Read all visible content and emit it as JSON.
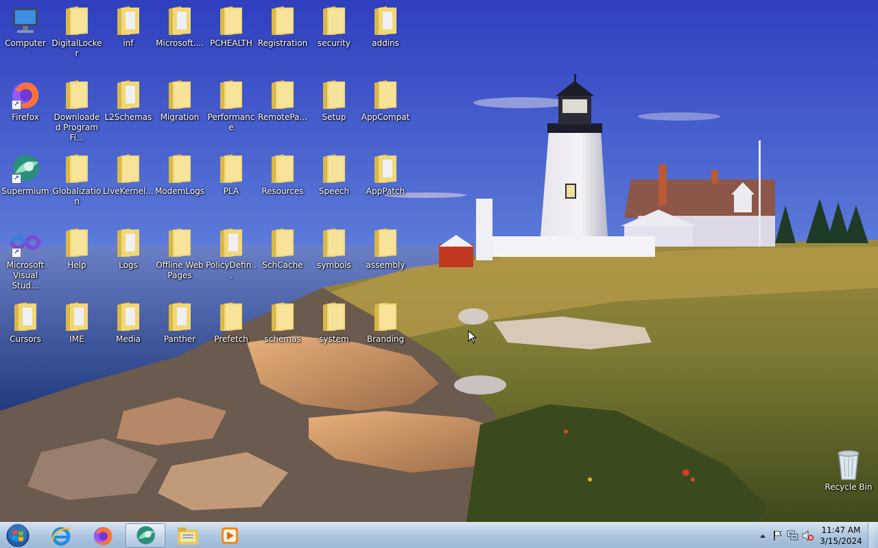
{
  "desktop": {
    "icons": [
      {
        "label": "Computer",
        "icon": "computer-icon"
      },
      {
        "label": "DigitalLocker",
        "icon": "folder-icon"
      },
      {
        "label": "inf",
        "icon": "folder-icon"
      },
      {
        "label": "Microsoft....",
        "icon": "folder-icon"
      },
      {
        "label": "PCHEALTH",
        "icon": "folder-icon"
      },
      {
        "label": "Registration",
        "icon": "folder-icon"
      },
      {
        "label": "security",
        "icon": "folder-icon"
      },
      {
        "label": "addins",
        "icon": "folder-icon"
      },
      {
        "label": "Firefox",
        "icon": "firefox-icon"
      },
      {
        "label": "Downloaded Program Fi...",
        "icon": "folder-icon"
      },
      {
        "label": "L2Schemas",
        "icon": "folder-icon"
      },
      {
        "label": "Migration",
        "icon": "folder-icon"
      },
      {
        "label": "Performance",
        "icon": "folder-icon"
      },
      {
        "label": "RemotePa...",
        "icon": "folder-icon"
      },
      {
        "label": "Setup",
        "icon": "folder-icon"
      },
      {
        "label": "AppCompat",
        "icon": "folder-icon"
      },
      {
        "label": "Supermium",
        "icon": "supermium-icon"
      },
      {
        "label": "Globalization",
        "icon": "folder-icon"
      },
      {
        "label": "LiveKernel...",
        "icon": "folder-icon"
      },
      {
        "label": "ModemLogs",
        "icon": "folder-icon"
      },
      {
        "label": "PLA",
        "icon": "folder-icon"
      },
      {
        "label": "Resources",
        "icon": "folder-icon"
      },
      {
        "label": "Speech",
        "icon": "folder-icon"
      },
      {
        "label": "AppPatch",
        "icon": "folder-icon"
      },
      {
        "label": "Microsoft Visual Stud...",
        "icon": "visual-studio-icon"
      },
      {
        "label": "Help",
        "icon": "folder-icon"
      },
      {
        "label": "Logs",
        "icon": "folder-icon"
      },
      {
        "label": "Offline Web Pages",
        "icon": "folder-icon"
      },
      {
        "label": "PolicyDefin...",
        "icon": "folder-icon"
      },
      {
        "label": "SchCache",
        "icon": "folder-icon"
      },
      {
        "label": "symbols",
        "icon": "folder-icon"
      },
      {
        "label": "assembly",
        "icon": "folder-icon"
      },
      {
        "label": "Cursors",
        "icon": "folder-icon"
      },
      {
        "label": "IME",
        "icon": "folder-icon"
      },
      {
        "label": "Media",
        "icon": "folder-icon"
      },
      {
        "label": "Panther",
        "icon": "folder-icon"
      },
      {
        "label": "Prefetch",
        "icon": "folder-icon"
      },
      {
        "label": "schemas",
        "icon": "folder-icon"
      },
      {
        "label": "system",
        "icon": "folder-icon"
      },
      {
        "label": "Branding",
        "icon": "folder-icon"
      }
    ],
    "recycle_bin": {
      "label": "Recycle Bin",
      "icon": "recycle-bin-icon"
    }
  },
  "taskbar": {
    "start": {
      "icon": "windows-start-icon"
    },
    "pinned": [
      {
        "name": "internet-explorer",
        "icon": "internet-explorer-icon",
        "active": false
      },
      {
        "name": "firefox",
        "icon": "firefox-icon",
        "active": false
      },
      {
        "name": "supermium",
        "icon": "supermium-icon",
        "active": true
      },
      {
        "name": "windows-explorer",
        "icon": "file-explorer-icon",
        "active": false
      },
      {
        "name": "media-player",
        "icon": "media-player-icon",
        "active": false
      }
    ],
    "tray": {
      "icons": [
        "show-hidden-icons-icon",
        "action-center-flag-icon",
        "network-icon",
        "volume-muted-icon"
      ],
      "time": "11:47 AM",
      "date": "3/15/2024"
    }
  },
  "colors": {
    "folder": "#f2d775",
    "taskbar": "#b4cbe3",
    "sky_top": "#3b4fc0",
    "sea": "#2f4f9a"
  }
}
